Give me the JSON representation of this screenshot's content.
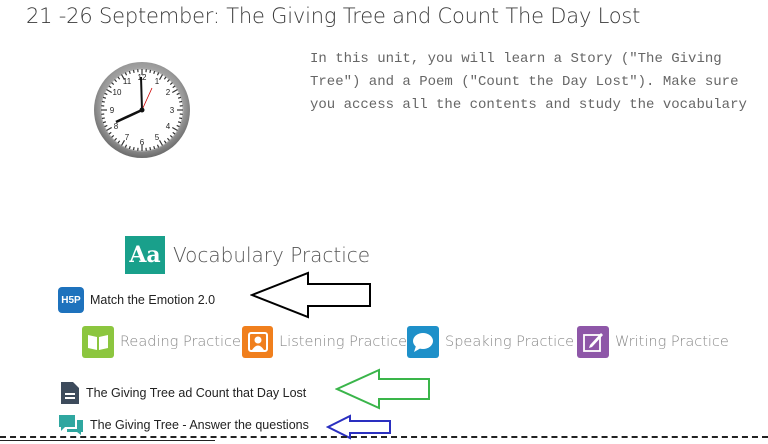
{
  "header": {
    "title": "21 -26 September: The Giving Tree and Count The Day Lost"
  },
  "intro": {
    "text": "In this unit, you will learn a Story (\"The Giving Tree\") and a Poem (\"Count the Day Lost\"). Make sure you access all the contents and study the vocabulary"
  },
  "activities": {
    "vocab": {
      "badge": "Aa",
      "label": "Vocabulary Practice"
    },
    "h5p": {
      "badge": "H5P",
      "label": "Match the Emotion 2.0"
    },
    "skills": [
      {
        "label": "Reading Practice",
        "icon": "book-icon",
        "color": "#8cc63f"
      },
      {
        "label": "Listening Practice",
        "icon": "person-icon",
        "color": "#f07f1d"
      },
      {
        "label": "Speaking Practice",
        "icon": "speech-bubble-icon",
        "color": "#1e90c9"
      },
      {
        "label": "Writing Practice",
        "icon": "pen-icon",
        "color": "#8e57a8"
      }
    ],
    "doc": {
      "label": "The Giving Tree ad Count that Day Lost"
    },
    "forum": {
      "label": "The Giving Tree - Answer the questions"
    }
  },
  "arrows": {
    "black": "#000000",
    "green": "#3ab54a",
    "blue": "#2a2fc0"
  }
}
